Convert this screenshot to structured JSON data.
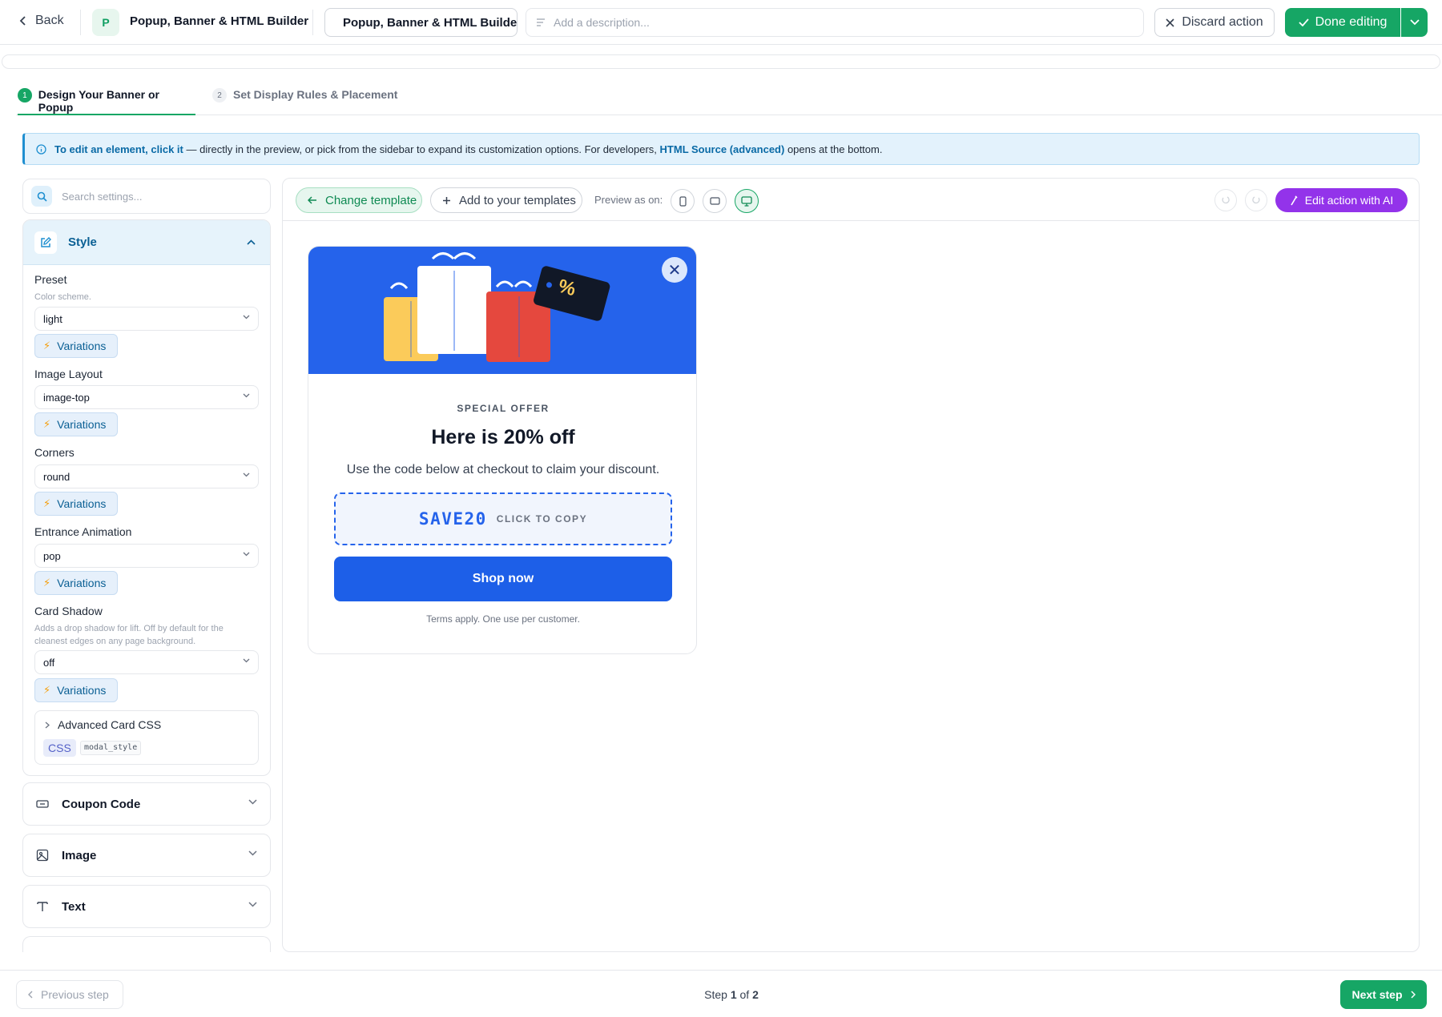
{
  "header": {
    "back_label": "Back",
    "app_badge": "P",
    "app_title": "Popup, Banner & HTML Builder",
    "name_value": "Popup, Banner & HTML Builder",
    "description_placeholder": "Add a description...",
    "discard_label": "Discard action",
    "done_label": "Done editing"
  },
  "steps": [
    {
      "number": "1",
      "label": "Design Your Banner or Popup",
      "active": true
    },
    {
      "number": "2",
      "label": "Set Display Rules & Placement",
      "active": false
    }
  ],
  "info": {
    "lead": "To edit an element, click it",
    "middle": " — directly in the preview, or pick from the sidebar to expand its customization options. For developers, ",
    "link": "HTML Source (advanced)",
    "tail": " opens at the bottom."
  },
  "sidebar": {
    "search_placeholder": "Search settings...",
    "style": {
      "title": "Style",
      "preset_label": "Preset",
      "preset_help": "Color scheme.",
      "preset_value": "light",
      "layout_label": "Image Layout",
      "layout_value": "image-top",
      "corners_label": "Corners",
      "corners_value": "round",
      "anim_label": "Entrance Animation",
      "anim_value": "pop",
      "shadow_label": "Card Shadow",
      "shadow_help": "Adds a drop shadow for lift. Off by default for the cleanest edges on any page background.",
      "shadow_value": "off",
      "variations_label": "Variations",
      "advanced_label": "Advanced Card CSS",
      "css_tag": "CSS",
      "css_key": "modal_style"
    },
    "sections": [
      {
        "label": "Coupon Code",
        "icon": "ticket-icon"
      },
      {
        "label": "Image",
        "icon": "image-icon"
      },
      {
        "label": "Text",
        "icon": "text-icon"
      }
    ]
  },
  "toolbar": {
    "change_template": "Change template",
    "add_template": "Add to your templates",
    "preview_label": "Preview as on:",
    "edit_ai": "Edit action with AI"
  },
  "popup": {
    "tag_symbol": "%",
    "close_symbol": "✕",
    "eyebrow": "SPECIAL OFFER",
    "headline": "Here is 20% off",
    "body": "Use the code below at checkout to claim your discount.",
    "code": "SAVE20",
    "copy_label": "CLICK TO COPY",
    "cta": "Shop now",
    "terms": "Terms apply. One use per customer."
  },
  "footer": {
    "prev_label": "Previous step",
    "step_prefix": "Step ",
    "step_current": "1",
    "step_mid": " of ",
    "step_total": "2",
    "next_label": "Next step"
  },
  "colors": {
    "primary_green": "#16a665",
    "accent_blue": "#2563eb",
    "ai_purple": "#9333ea",
    "info_blue": "#0a6aa6"
  }
}
